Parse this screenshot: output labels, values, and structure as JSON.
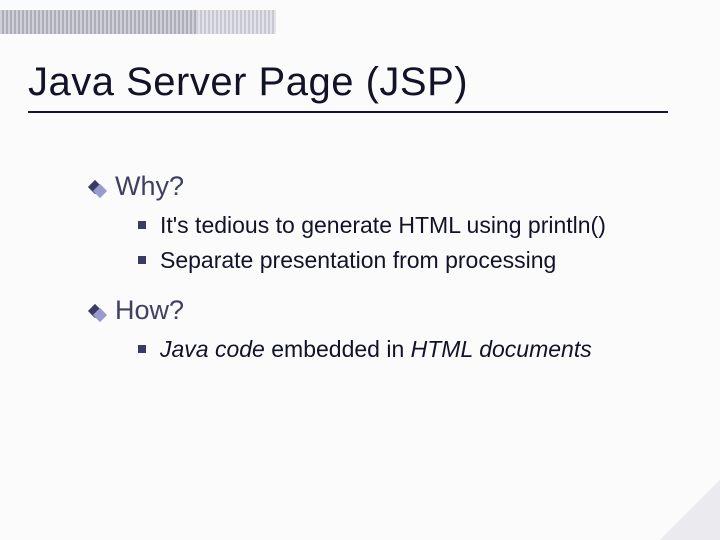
{
  "title": "Java Server Page (JSP)",
  "sections": [
    {
      "heading": "Why?",
      "items": [
        {
          "text": "It's tedious to generate HTML using println()"
        },
        {
          "text": "Separate presentation from processing"
        }
      ]
    },
    {
      "heading": "How?",
      "items": [
        {
          "parts": [
            {
              "text": "Java code",
              "italic": true
            },
            {
              "text": " embedded in ",
              "italic": false
            },
            {
              "text": "HTML documents",
              "italic": true
            }
          ]
        }
      ]
    }
  ]
}
